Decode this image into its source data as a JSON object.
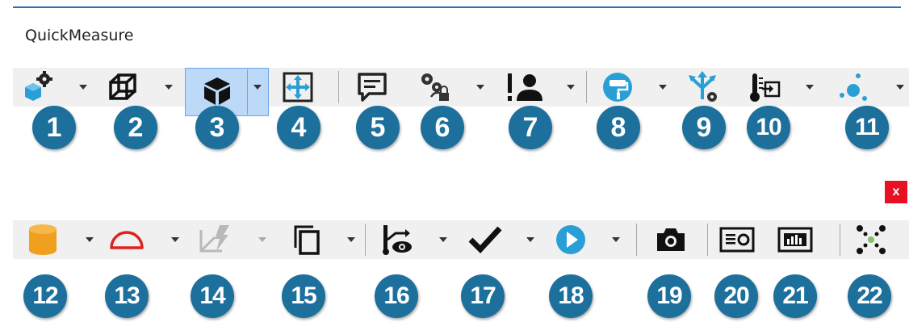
{
  "window": {
    "title": "QuickMeasure",
    "close_label": "x"
  },
  "colors": {
    "badge": "#1d6f9c",
    "accent_blue": "#2a9fd6",
    "orange": "#f0a01e",
    "red": "#e02020",
    "dark": "#222222",
    "close_bg": "#e81123"
  },
  "toolbar_top": [
    {
      "icon": "component-settings-icon",
      "badge": "1",
      "dropdown": true
    },
    {
      "icon": "wireframe-cube-icon",
      "badge": "2",
      "dropdown": true
    },
    {
      "icon": "solid-cube-icon",
      "badge": "3",
      "dropdown": true,
      "selected": true
    },
    {
      "icon": "move-icon",
      "badge": "4",
      "dropdown": false
    },
    {
      "icon": "comment-icon",
      "badge": "5",
      "dropdown": false
    },
    {
      "icon": "gears-lock-icon",
      "badge": "6",
      "dropdown": true
    },
    {
      "icon": "user-alert-icon",
      "badge": "7",
      "dropdown": true
    },
    {
      "icon": "paint-roller-icon",
      "badge": "8",
      "dropdown": true
    },
    {
      "icon": "axis-settings-icon",
      "badge": "9",
      "dropdown": false
    },
    {
      "icon": "thermometer-export-icon",
      "badge": "10",
      "dropdown": true
    },
    {
      "icon": "scatter-dots-icon",
      "badge": "11",
      "dropdown": true
    }
  ],
  "toolbar_bottom": [
    {
      "icon": "cylinder-icon",
      "badge": "12",
      "dropdown": true
    },
    {
      "icon": "protractor-icon",
      "badge": "13",
      "dropdown": true
    },
    {
      "icon": "lightning-axes-icon",
      "badge": "14",
      "dropdown": true
    },
    {
      "icon": "copy-icon",
      "badge": "15",
      "dropdown": true
    },
    {
      "icon": "path-view-icon",
      "badge": "16",
      "dropdown": true
    },
    {
      "icon": "checkmark-icon",
      "badge": "17",
      "dropdown": true
    },
    {
      "icon": "play-icon",
      "badge": "18",
      "dropdown": true
    },
    {
      "icon": "camera-icon",
      "badge": "19",
      "dropdown": false
    },
    {
      "icon": "report-image-icon",
      "badge": "20",
      "dropdown": false
    },
    {
      "icon": "report-chart-icon",
      "badge": "21",
      "dropdown": false
    },
    {
      "icon": "cross-dots-icon",
      "badge": "22",
      "dropdown": false
    }
  ]
}
